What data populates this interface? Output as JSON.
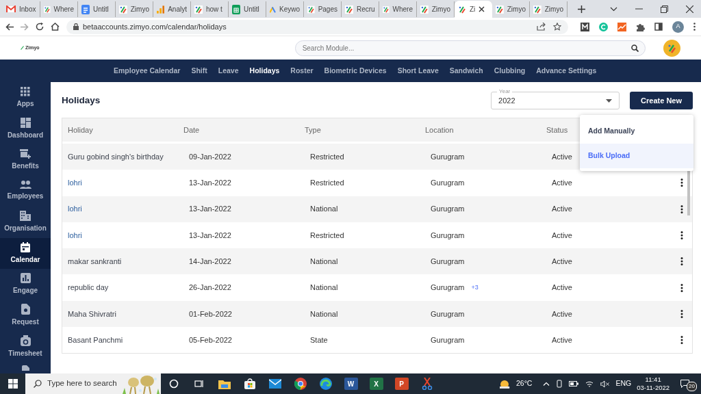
{
  "browser": {
    "tabs": [
      {
        "title": "Inbox",
        "kind": "gmail",
        "selected": false
      },
      {
        "title": "Where",
        "kind": "zimyo",
        "selected": false
      },
      {
        "title": "Untitl",
        "kind": "docs",
        "selected": false
      },
      {
        "title": "Zimyo",
        "kind": "zimyo",
        "selected": false
      },
      {
        "title": "Analyt",
        "kind": "analytics",
        "selected": false
      },
      {
        "title": "how t",
        "kind": "zimyo",
        "selected": false
      },
      {
        "title": "Untitl",
        "kind": "sheets",
        "selected": false
      },
      {
        "title": "Keywo",
        "kind": "ads",
        "selected": false
      },
      {
        "title": "Pages",
        "kind": "zimyo",
        "selected": false
      },
      {
        "title": "Recru",
        "kind": "zimyo",
        "selected": false
      },
      {
        "title": "Where",
        "kind": "zimyo",
        "selected": false
      },
      {
        "title": "Zimyo",
        "kind": "zimyo",
        "selected": false
      },
      {
        "title": "Zi",
        "kind": "zimyo",
        "selected": true
      },
      {
        "title": "Zimyo",
        "kind": "zimyo",
        "selected": false
      },
      {
        "title": "Zimyo",
        "kind": "zimyo",
        "selected": false
      }
    ],
    "address": "betaaccounts.zimyo.com/calendar/holidays",
    "profile": "A"
  },
  "app": {
    "logo": "Zimyo",
    "search": {
      "placeholder": "Search Module..."
    }
  },
  "nav": [
    {
      "label": "Employee Calendar",
      "selected": false
    },
    {
      "label": "Shift",
      "selected": false
    },
    {
      "label": "Leave",
      "selected": false
    },
    {
      "label": "Holidays",
      "selected": true
    },
    {
      "label": "Roster",
      "selected": false
    },
    {
      "label": "Biometric Devices",
      "selected": false
    },
    {
      "label": "Short Leave",
      "selected": false
    },
    {
      "label": "Sandwich",
      "selected": false
    },
    {
      "label": "Clubbing",
      "selected": false
    },
    {
      "label": "Advance Settings",
      "selected": false
    }
  ],
  "sidebar": [
    {
      "label": "Apps",
      "kind": "grid",
      "selected": false
    },
    {
      "label": "Dashboard",
      "kind": "dashboard",
      "selected": false
    },
    {
      "label": "Benefits",
      "kind": "benefits",
      "selected": false
    },
    {
      "label": "Employees",
      "kind": "people",
      "selected": false
    },
    {
      "label": "Organisation",
      "kind": "building",
      "selected": false
    },
    {
      "label": "Calendar",
      "kind": "calendar",
      "selected": true
    },
    {
      "label": "Engage",
      "kind": "chart",
      "selected": false
    },
    {
      "label": "Request",
      "kind": "doc",
      "selected": false
    },
    {
      "label": "Timesheet",
      "kind": "timer",
      "selected": false
    }
  ],
  "page": {
    "title": "Holidays",
    "year": {
      "label": "Year",
      "value": "2022"
    },
    "create_button": "Create New",
    "menu": [
      {
        "label": "Add Manually",
        "selected": false
      },
      {
        "label": "Bulk Upload",
        "selected": true
      }
    ]
  },
  "table": {
    "columns": [
      "Holiday",
      "Date",
      "Type",
      "Location",
      "Status"
    ],
    "rows": [
      {
        "holiday": "Guru gobind singh's birthday",
        "color": "#3a3f4a",
        "date": "09-Jan-2022",
        "type": "Restricted",
        "location": "Gurugram",
        "status": "Active"
      },
      {
        "holiday": "lohri",
        "color": "#2c5f9e",
        "date": "13-Jan-2022",
        "type": "Restricted",
        "location": "Gurugram",
        "status": "Active"
      },
      {
        "holiday": "lohri",
        "color": "#2c5f9e",
        "date": "13-Jan-2022",
        "type": "National",
        "location": "Gurugram",
        "status": "Active"
      },
      {
        "holiday": "lohri",
        "color": "#2c5f9e",
        "date": "13-Jan-2022",
        "type": "Restricted",
        "location": "Gurugram",
        "status": "Active"
      },
      {
        "holiday": "makar sankranti",
        "color": "#3a3f4a",
        "date": "14-Jan-2022",
        "type": "National",
        "location": "Gurugram",
        "status": "Active"
      },
      {
        "holiday": "republic day",
        "color": "#3a3f4a",
        "date": "26-Jan-2022",
        "type": "National",
        "location": "Gurugram",
        "more": "+3",
        "status": "Active"
      },
      {
        "holiday": "Maha Shivratri",
        "color": "#3a3f4a",
        "date": "01-Feb-2022",
        "type": "National",
        "location": "Gurugram",
        "status": "Active"
      },
      {
        "holiday": "Basant Panchmi",
        "color": "#3a3f4a",
        "date": "05-Feb-2022",
        "type": "State",
        "location": "Gurugram",
        "status": "Active"
      }
    ]
  },
  "taskbar": {
    "search_placeholder": "Type here to search",
    "apps": [
      {
        "kind": "cortana"
      },
      {
        "kind": "taskview"
      },
      {
        "kind": "explorer"
      },
      {
        "kind": "store"
      },
      {
        "kind": "mail"
      },
      {
        "kind": "chrome"
      },
      {
        "kind": "edge"
      },
      {
        "kind": "word",
        "glyph": "W"
      },
      {
        "kind": "excel",
        "glyph": "X"
      },
      {
        "kind": "powerpoint",
        "glyph": "P"
      },
      {
        "kind": "snip"
      }
    ],
    "weather": "26°C",
    "language": "ENG",
    "time": "11:41",
    "date": "03-11-2022",
    "notifications": "20"
  }
}
